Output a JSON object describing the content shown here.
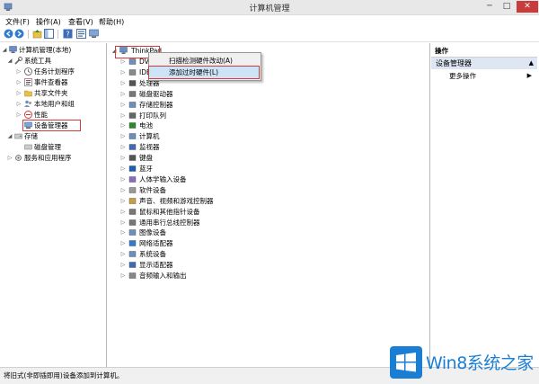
{
  "window": {
    "title": "计算机管理",
    "controls": {
      "minimize": "─",
      "maximize": "□",
      "close": "✕"
    }
  },
  "menu": [
    "文件(F)",
    "操作(A)",
    "查看(V)",
    "帮助(H)"
  ],
  "toolbar": [
    "back-icon",
    "forward-icon",
    "up-icon",
    "show-hide-tree-icon",
    "help-icon",
    "properties-icon",
    "console-icon"
  ],
  "left_tree": {
    "root": "计算机管理(本地)",
    "system_tools": "系统工具",
    "items": [
      "任务计划程序",
      "事件查看器",
      "共享文件夹",
      "本地用户和组",
      "性能",
      "设备管理器"
    ],
    "storage": "存储",
    "storage_items": [
      "磁盘管理"
    ],
    "services": "服务和应用程序"
  },
  "device_tree": {
    "root": "ThinkPad",
    "items": [
      "DV",
      "IDE",
      "处理器",
      "磁盘驱动器",
      "存储控制器",
      "打印队列",
      "电池",
      "计算机",
      "监视器",
      "键盘",
      "蓝牙",
      "人体学输入设备",
      "软件设备",
      "声音、视频和游戏控制器",
      "鼠标和其他指针设备",
      "通用串行总线控制器",
      "图像设备",
      "网络适配器",
      "系统设备",
      "显示适配器",
      "音频输入和输出"
    ]
  },
  "context_menu": {
    "items": [
      "扫描检测硬件改动(A)",
      "添加过时硬件(L)"
    ],
    "highlighted": 1
  },
  "actions": {
    "header": "操作",
    "section": "设备管理器",
    "items": [
      "更多操作"
    ]
  },
  "status": "将旧式(非即插即用)设备添加到计算机。",
  "watermark": {
    "text": "Win8系统之家"
  },
  "colors": {
    "accent": "#1a7fd4",
    "highlight": "#cde4f7",
    "selection_box": "#d23c3c",
    "section": "#dde6f2"
  }
}
